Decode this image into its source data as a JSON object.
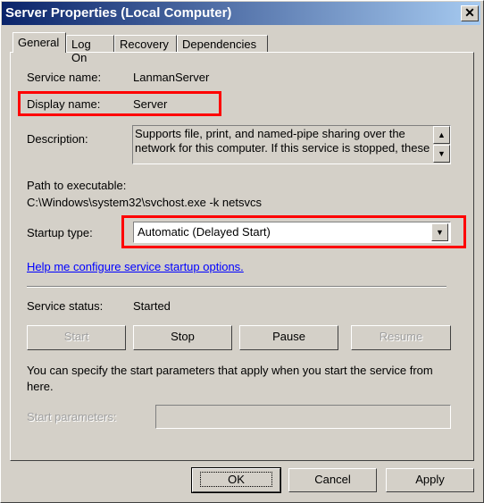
{
  "window": {
    "title": "Server Properties (Local Computer)",
    "close": "✕"
  },
  "tabs": [
    {
      "label": "General"
    },
    {
      "label": "Log On"
    },
    {
      "label": "Recovery"
    },
    {
      "label": "Dependencies"
    }
  ],
  "general": {
    "service_name_label": "Service name:",
    "service_name": "LanmanServer",
    "display_name_label": "Display name:",
    "display_name": "Server",
    "description_label": "Description:",
    "description": "Supports file, print, and named-pipe sharing over the network for this computer. If this service is stopped, these",
    "path_label": "Path to executable:",
    "path": "C:\\Windows\\system32\\svchost.exe -k netsvcs",
    "startup_label": "Startup type:",
    "startup_value": "Automatic (Delayed Start)",
    "help_link": "Help me configure service startup options.",
    "status_label": "Service status:",
    "status": "Started",
    "buttons": {
      "start": "Start",
      "stop": "Stop",
      "pause": "Pause",
      "resume": "Resume"
    },
    "params_text": "You can specify the start parameters that apply when you start the service from here.",
    "params_label": "Start parameters:",
    "params_value": ""
  },
  "footer": {
    "ok": "OK",
    "cancel": "Cancel",
    "apply": "Apply"
  },
  "highlight_color": "#ff0000"
}
